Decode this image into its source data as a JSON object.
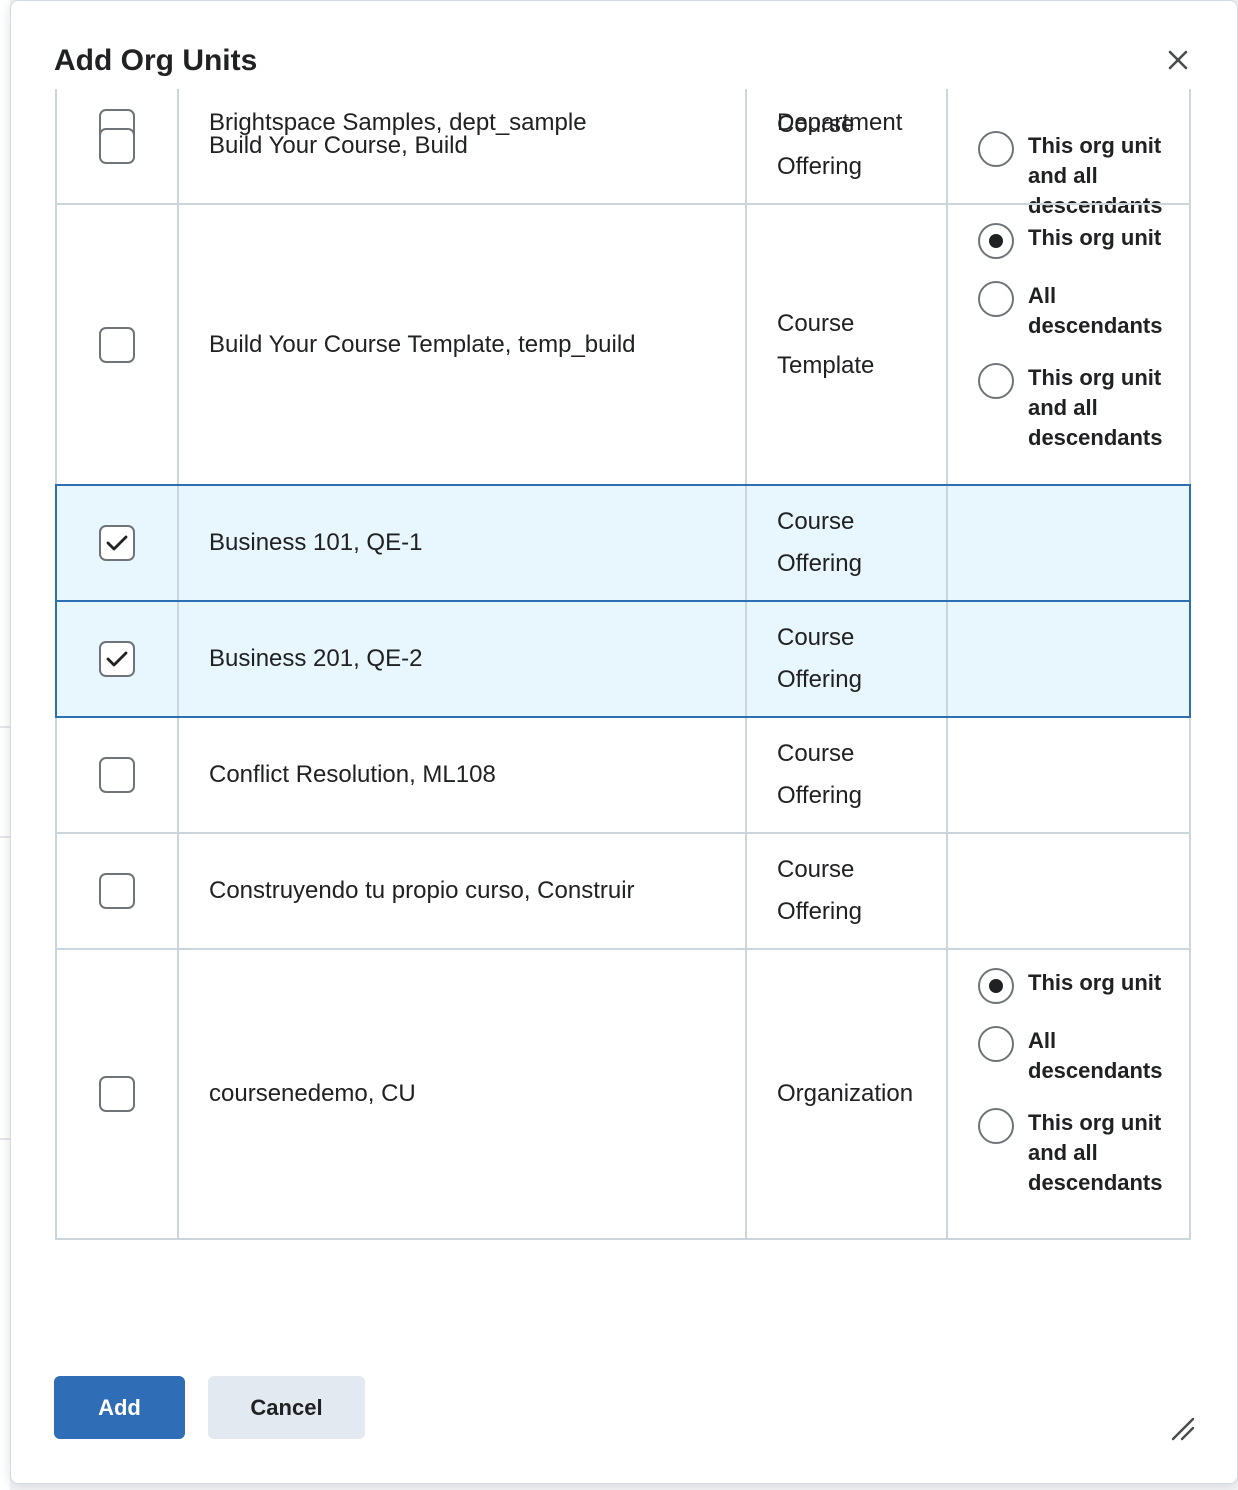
{
  "dialog": {
    "title": "Add Org Units",
    "close_label": "Close",
    "add_label": "Add",
    "cancel_label": "Cancel"
  },
  "rows": [
    {
      "name": "Brightspace Samples, dept_sample",
      "type": "Department",
      "checked": false,
      "selected": false,
      "height": 158,
      "scope": {
        "options": [
          "All descendants",
          "This org unit and all descendants"
        ],
        "partial_first": true
      }
    },
    {
      "name": "Build Your Course, Build",
      "type": "Course Offering",
      "checked": false,
      "selected": false
    },
    {
      "name": "Build Your Course Template, temp_build",
      "type": "Course Template",
      "checked": false,
      "selected": false,
      "scope": {
        "options": [
          "This org unit",
          "All descendants",
          "This org unit and all descendants"
        ],
        "selected_index": 0
      }
    },
    {
      "name": "Business 101, QE-1",
      "type": "Course Offering",
      "checked": true,
      "selected": true
    },
    {
      "name": "Business 201, QE-2",
      "type": "Course Offering",
      "checked": true,
      "selected": true
    },
    {
      "name": "Conflict Resolution, ML108",
      "type": "Course Offering",
      "checked": false,
      "selected": false
    },
    {
      "name": "Construyendo tu propio curso, Construir",
      "type": "Course Offering",
      "checked": false,
      "selected": false
    },
    {
      "name": "coursenedemo, CU",
      "type": "Organization",
      "checked": false,
      "selected": false,
      "scope": {
        "options": [
          "This org unit",
          "All descendants",
          "This org unit and all descendants"
        ],
        "selected_index": 0
      }
    }
  ]
}
